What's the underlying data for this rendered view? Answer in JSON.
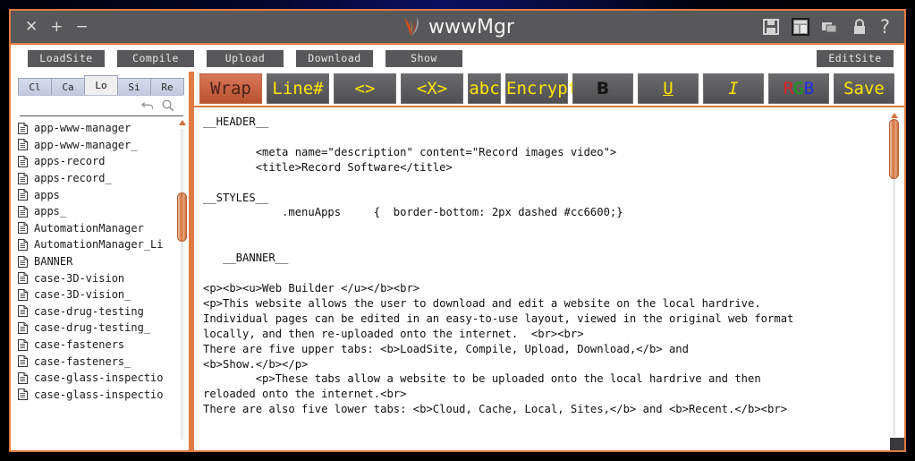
{
  "window": {
    "title": "wwwMgr",
    "controls": {
      "close": "✕",
      "maximize": "+",
      "minimize": "−"
    },
    "right_icons": [
      {
        "name": "save-icon",
        "label": "Save"
      },
      {
        "name": "layout-icon",
        "label": "Layout"
      },
      {
        "name": "windows-icon",
        "label": "Windows"
      },
      {
        "name": "lock-icon",
        "label": "Lock"
      },
      {
        "name": "help-icon",
        "label": "?"
      }
    ],
    "frame_color": "#e07b43",
    "titlebar_color": "#58585a"
  },
  "actionbar": {
    "left_buttons": [
      {
        "label": "LoadSite"
      },
      {
        "label": "Compile"
      },
      {
        "label": "Upload"
      },
      {
        "label": "Download"
      },
      {
        "label": "Show"
      }
    ],
    "right_buttons": [
      {
        "label": "EditSite"
      }
    ]
  },
  "sidebar": {
    "tabs": [
      {
        "label": "Cl",
        "active": false
      },
      {
        "label": "Ca",
        "active": false
      },
      {
        "label": "Lo",
        "active": true
      },
      {
        "label": "Si",
        "active": false
      },
      {
        "label": "Re",
        "active": false
      }
    ],
    "tools": [
      {
        "name": "back-arrow-icon"
      },
      {
        "name": "search-icon"
      }
    ],
    "files": [
      "app-www-manager",
      "app-www-manager_",
      "apps-record",
      "apps-record_",
      "apps",
      "apps_",
      "AutomationManager",
      "AutomationManager_Li",
      "BANNER",
      "case-3D-vision",
      "case-3D-vision_",
      "case-drug-testing",
      "case-drug-testing_",
      "case-fasteners",
      "case-fasteners_",
      "case-glass-inspectio",
      "case-glass-inspectio"
    ],
    "scrollbar": {
      "thumb_top_pct": 22,
      "thumb_height_pct": 15
    }
  },
  "editor": {
    "toolbar": [
      {
        "label": "Wrap",
        "style": "wrap",
        "name": "wrap-button"
      },
      {
        "label": "Line#",
        "style": "plain",
        "name": "line-number-button"
      },
      {
        "label": "<>",
        "style": "plain",
        "name": "tag-button"
      },
      {
        "label": "<X>",
        "style": "plain",
        "name": "close-tag-button"
      },
      {
        "label": "abc",
        "style": "plain",
        "name": "abc-button"
      },
      {
        "label": "Encrypt",
        "style": "plain",
        "name": "encrypt-button"
      },
      {
        "label": "B",
        "style": "bold",
        "name": "bold-button"
      },
      {
        "label": "U",
        "style": "under",
        "name": "underline-button"
      },
      {
        "label": "I",
        "style": "ital",
        "name": "italic-button"
      },
      {
        "label": "RGB",
        "style": "rgb",
        "name": "color-button"
      },
      {
        "label": "Save",
        "style": "plain",
        "name": "save-button"
      }
    ],
    "code": "__HEADER__\n\n        <meta name=\"description\" content=\"Record images video\">\n        <title>Record Software</title>\n\n__STYLES__\n            .menuApps     {  border-bottom: 2px dashed #cc6600;}\n\n\n   __BANNER__\n\n<p><b><u>Web Builder </u></b><br>\n<p>This website allows the user to download and edit a website on the local hardrive.\nIndividual pages can be edited in an easy-to-use layout, viewed in the original web format\nlocally, and then re-uploaded onto the internet.  <br><br>\nThere are five upper tabs: <b>LoadSite, Compile, Upload, Download,</b> and\n<b>Show.</b></p>\n        <p>These tabs allow a website to be uploaded onto the local hardrive and then\nreloaded onto the internet.<br>\nThere are also five lower tabs: <b>Cloud, Cache, Local, Sites,</b> and <b>Recent.</b><br>",
    "scrollbar": {
      "thumb_top_pct": 2,
      "thumb_height_pct": 18
    }
  }
}
